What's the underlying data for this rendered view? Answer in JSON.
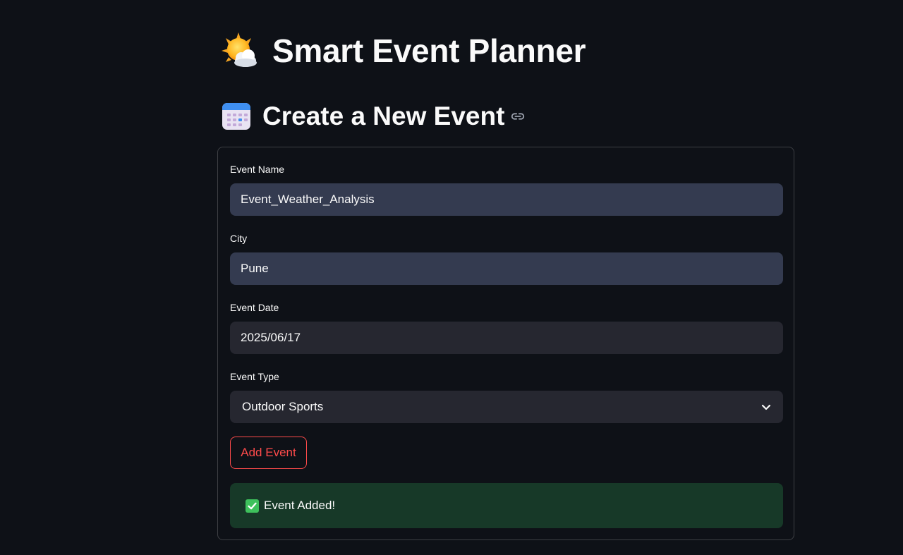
{
  "header": {
    "title": "Smart Event Planner",
    "title_icon": "sun-behind-cloud-icon"
  },
  "section": {
    "heading": "Create a New Event",
    "heading_icon": "calendar-icon",
    "anchor_icon": "link-icon"
  },
  "form": {
    "event_name": {
      "label": "Event Name",
      "value": "Event_Weather_Analysis"
    },
    "city": {
      "label": "City",
      "value": "Pune"
    },
    "event_date": {
      "label": "Event Date",
      "value": "2025/06/17"
    },
    "event_type": {
      "label": "Event Type",
      "value": "Outdoor Sports"
    },
    "submit_label": "Add Event"
  },
  "alert": {
    "icon": "check-mark-button-icon",
    "message": "Event Added!"
  },
  "colors": {
    "background": "#0e1117",
    "input_active": "#343b50",
    "input_plain": "#262730",
    "primary_red": "#ff4b4b",
    "success_bg": "#173928",
    "success_check": "#3ec15c"
  }
}
